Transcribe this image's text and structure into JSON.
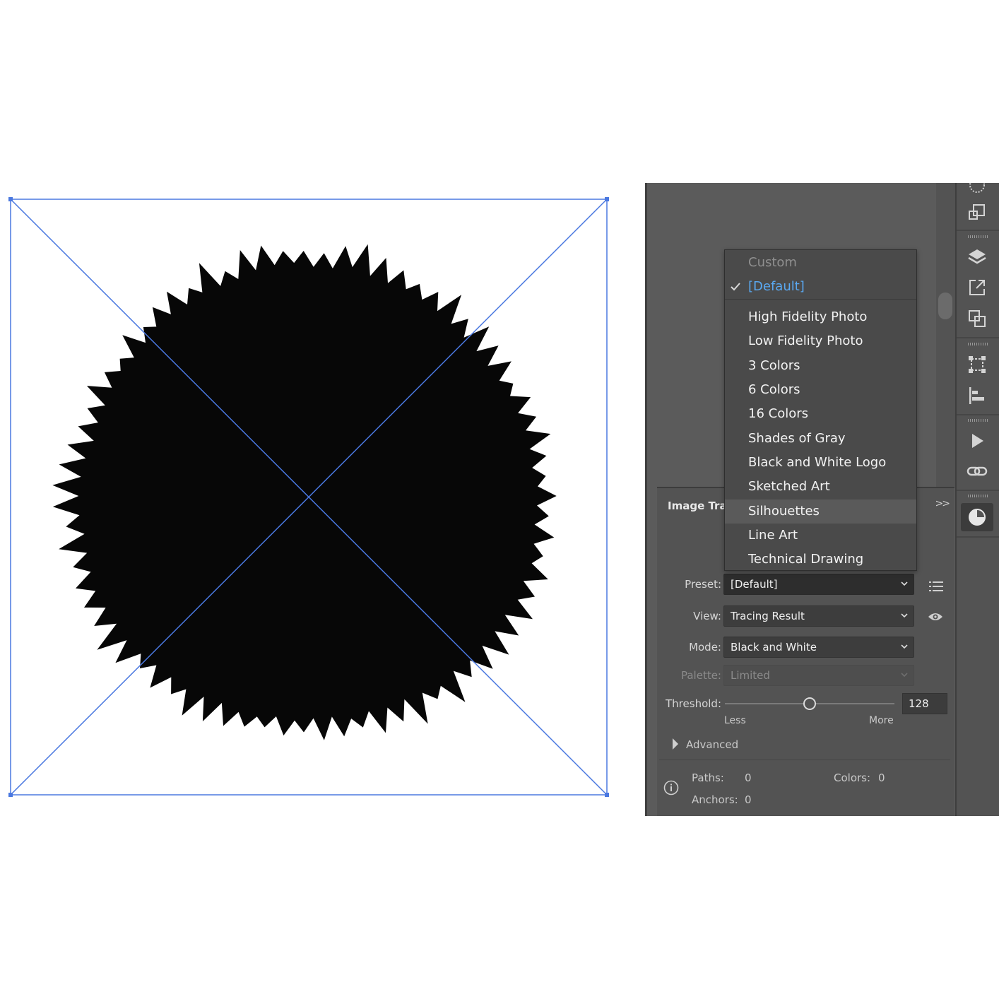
{
  "panel": {
    "title": "Image Tra",
    "preset_label": "Preset:",
    "preset_value": "[Default]",
    "view_label": "View:",
    "view_value": "Tracing Result",
    "mode_label": "Mode:",
    "mode_value": "Black and White",
    "palette_label": "Palette:",
    "palette_value": "Limited",
    "threshold_label": "Threshold:",
    "threshold_value": "128",
    "threshold_fraction": 0.5,
    "slider_less": "Less",
    "slider_more": "More",
    "advanced_label": "Advanced",
    "paths_label": "Paths:",
    "paths_value": "0",
    "colors_label": "Colors:",
    "colors_value": "0",
    "anchors_label": "Anchors:",
    "anchors_value": "0",
    "collapse_glyph": ">>"
  },
  "preset_menu": {
    "items": [
      {
        "label": "Custom",
        "state": "disabled"
      },
      {
        "label": "[Default]",
        "state": "selected"
      },
      {
        "label": "High Fidelity Photo",
        "state": "normal"
      },
      {
        "label": "Low Fidelity Photo",
        "state": "normal"
      },
      {
        "label": "3 Colors",
        "state": "normal"
      },
      {
        "label": "6 Colors",
        "state": "normal"
      },
      {
        "label": "16 Colors",
        "state": "normal"
      },
      {
        "label": "Shades of Gray",
        "state": "normal"
      },
      {
        "label": "Black and White Logo",
        "state": "normal"
      },
      {
        "label": "Sketched Art",
        "state": "normal"
      },
      {
        "label": "Silhouettes",
        "state": "hover"
      },
      {
        "label": "Line Art",
        "state": "normal"
      },
      {
        "label": "Technical Drawing",
        "state": "normal"
      }
    ]
  },
  "dock_icons": [
    "arrange-icon",
    "layers-icon",
    "export-icon",
    "pathfinder-icon",
    "transform-icon",
    "align-icon",
    "play-icon",
    "links-icon",
    "image-trace-icon"
  ],
  "colors": {
    "selection_blue": "#4a78e0",
    "selected_item_blue": "#5aa9f2",
    "panel_bg": "#535353",
    "shape_fill": "#070707"
  }
}
